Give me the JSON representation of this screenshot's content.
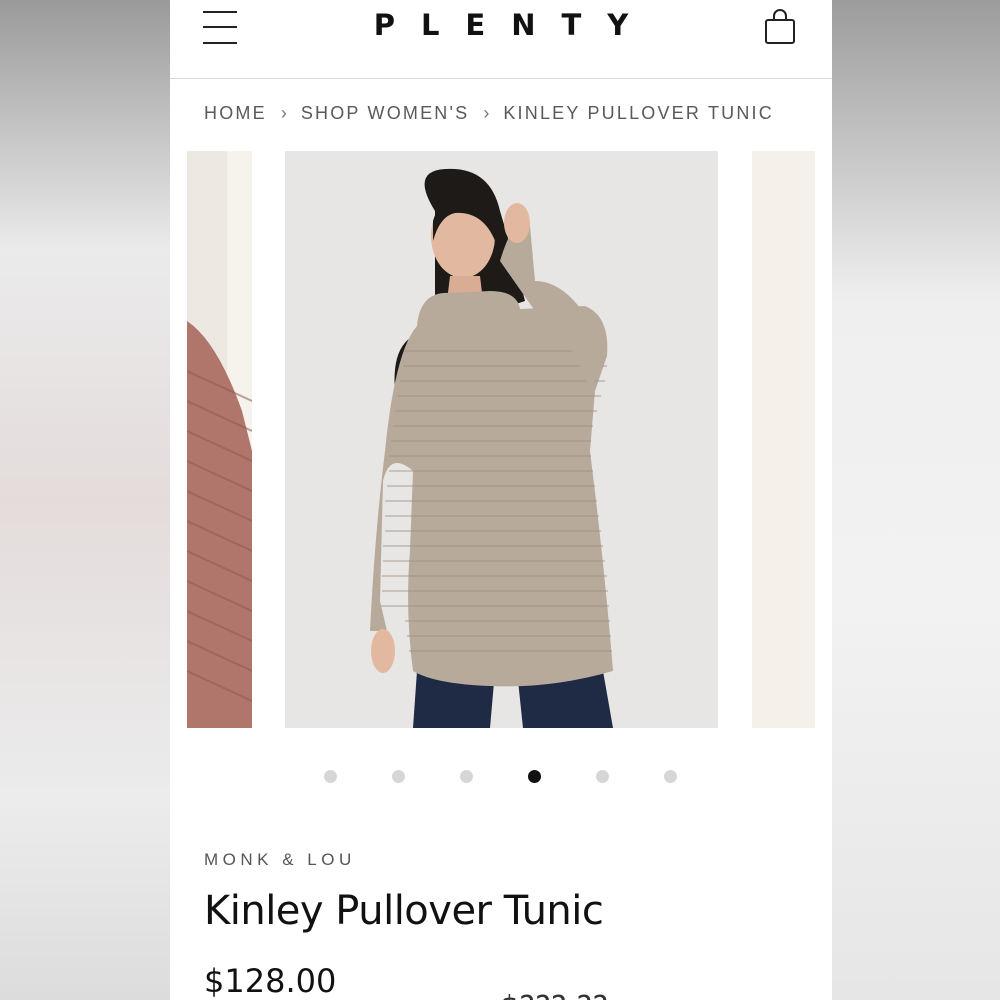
{
  "header": {
    "logo": "PLENTY",
    "menu_icon": "hamburger-menu-icon",
    "cart_icon": "shopping-bag-icon"
  },
  "breadcrumb": {
    "items": [
      "HOME",
      "SHOP WOMEN'S",
      "KINLEY PULLOVER TUNIC"
    ],
    "separator": "›"
  },
  "gallery": {
    "slides": 6,
    "active_index": 3
  },
  "product": {
    "brand": "MONK & LOU",
    "title": "Kinley Pullover Tunic",
    "price": "$128.00",
    "partial_price": "$???.??"
  },
  "colors": {
    "sweater": "#b7aa9b",
    "jeans": "#1f2a44",
    "side_sweater": "#b0756b",
    "dot_active": "#111111",
    "dot_inactive": "#d6d6d6"
  }
}
